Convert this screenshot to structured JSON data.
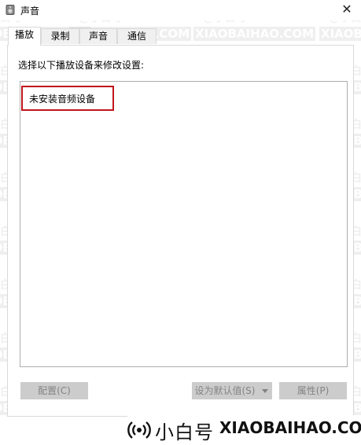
{
  "window": {
    "title": "声音",
    "close_glyph": "✕"
  },
  "tabs": [
    {
      "label": "播放",
      "active": true
    },
    {
      "label": "录制",
      "active": false
    },
    {
      "label": "声音",
      "active": false
    },
    {
      "label": "通信",
      "active": false
    }
  ],
  "playback": {
    "instruction": "选择以下播放设备来修改设置:",
    "empty_message": "未安装音频设备"
  },
  "buttons": {
    "configure": "配置(C)",
    "set_default": "设为默认值(S)",
    "properties": "属性(P)"
  },
  "watermark": {
    "line1": "@小白号",
    "line2": "XIAOBAIHAO.COM"
  },
  "brand": {
    "cn": "小白号",
    "en": "XIAOBAIHAO.COM"
  },
  "colors": {
    "highlight_box": "#c0161c",
    "disabled_button_bg": "#cccccc",
    "disabled_button_text": "#838383"
  }
}
